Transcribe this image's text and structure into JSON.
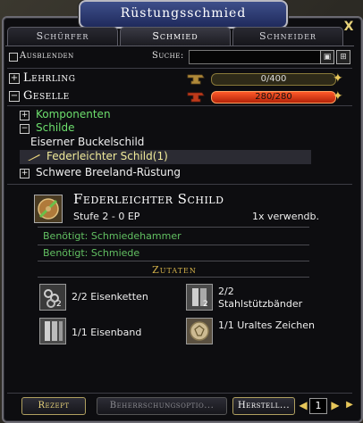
{
  "window": {
    "title": "Rüstungsschmied",
    "close_icon": "close-x-icon"
  },
  "tabs": [
    {
      "label": "Schürfer",
      "active": false
    },
    {
      "label": "Schmied",
      "active": true
    },
    {
      "label": "Schneider",
      "active": false
    }
  ],
  "filter": {
    "hide_label": "Ausblenden",
    "search_label": "Suche:",
    "search_value": "",
    "search_placeholder": "",
    "hide_checked": false
  },
  "skills": [
    {
      "name": "Lehrling",
      "progress_text": "0/400",
      "progress": 0.0,
      "expanded": false
    },
    {
      "name": "Geselle",
      "progress_text": "280/280",
      "progress": 1.0,
      "expanded": true
    }
  ],
  "tree": {
    "komponenten": "Komponenten",
    "schilde": "Schilde",
    "item1": "Eiserner Buckelschild",
    "item2": "Federleichter Schild(1)",
    "item3": "Schwere Breeland-Rüstung"
  },
  "recipe": {
    "title": "Federleichter Schild",
    "subtitle": "Stufe 2 - 0 EP",
    "uses": "1x verwendb.",
    "req_tool": "Benötigt: Schmiedehammer",
    "req_station": "Benötigt: Schmiede"
  },
  "ingredients_header": "Zutaten",
  "ingredients": [
    {
      "text": "2/2 Eisenketten",
      "badge": "2",
      "icon": "chain-icon"
    },
    {
      "text": "2/2 Stahlstützbänder",
      "badge": "2",
      "icon": "steel-band-icon"
    },
    {
      "text": "1/1 Eisenband",
      "badge": "",
      "icon": "iron-band-icon"
    },
    {
      "text": "1/1 Uraltes Zeichen",
      "badge": "",
      "icon": "ancient-token-icon"
    }
  ],
  "bottom": {
    "recipe_tab": "Rezept",
    "mastery_tab": "Beherrschungsoptio...",
    "make_button": "Herstell...",
    "quantity": "1"
  },
  "colors": {
    "window_bg": "#0d0d10",
    "title_bg": "#2b3a74",
    "green_text": "#6ddf6d",
    "gold_text": "#d4b24a",
    "progress_red": "#e23c12"
  }
}
